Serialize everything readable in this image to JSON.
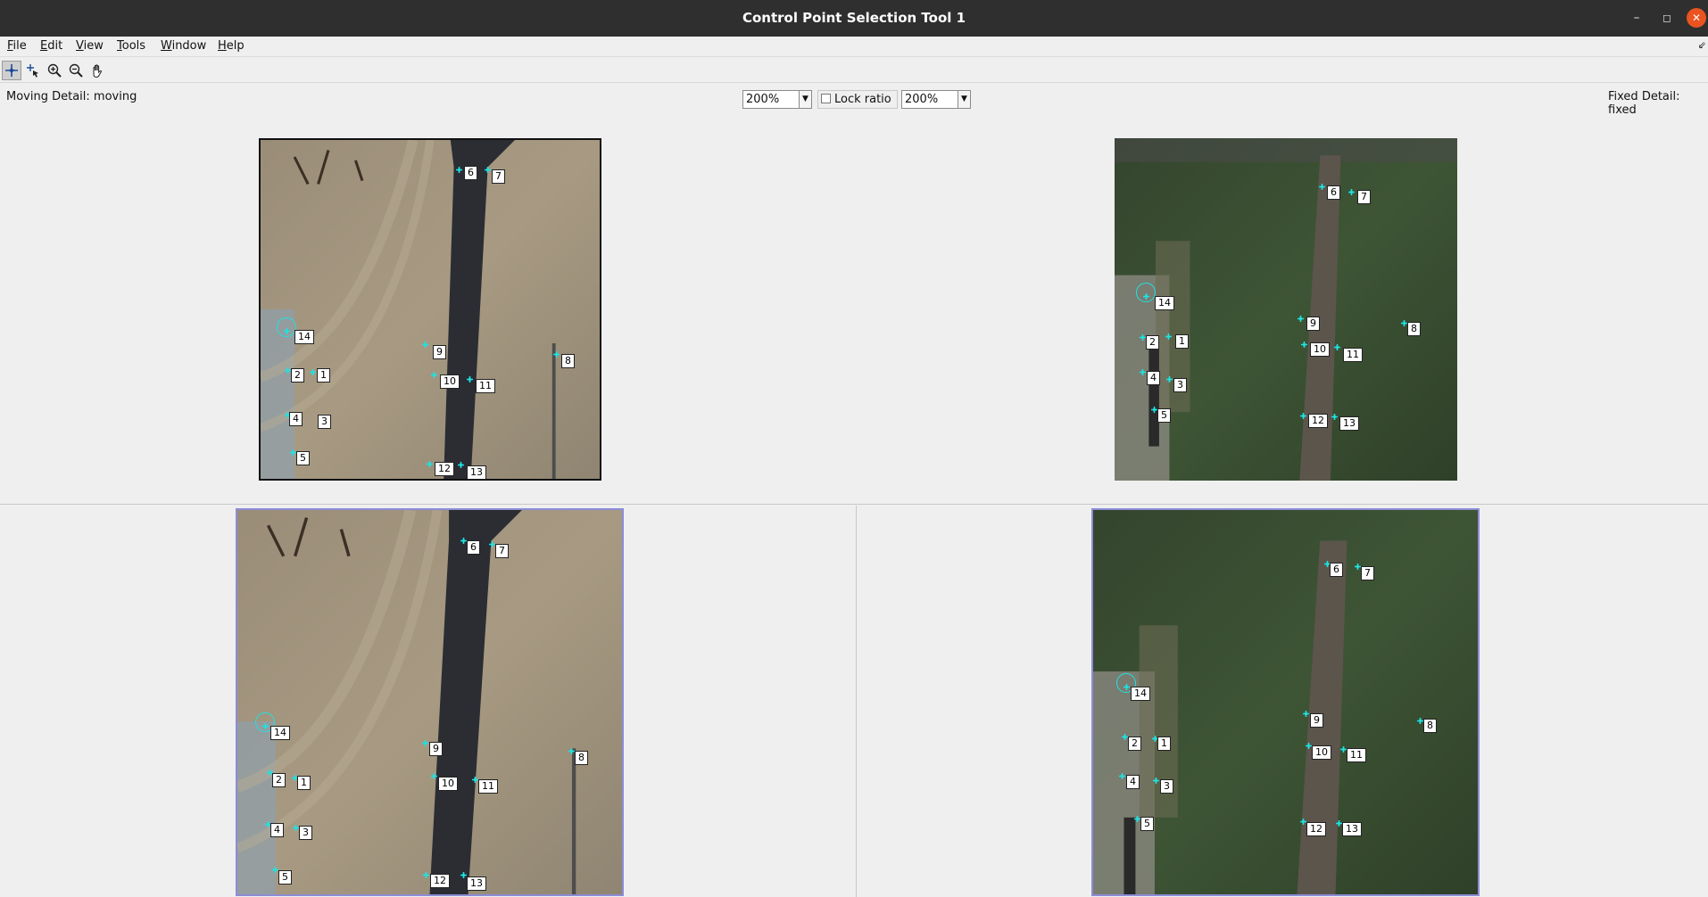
{
  "window": {
    "title": "Control Point Selection Tool 1"
  },
  "menu": [
    {
      "label": "File",
      "u": "F",
      "rest": "ile"
    },
    {
      "label": "Edit",
      "u": "E",
      "rest": "dit"
    },
    {
      "label": "View",
      "u": "V",
      "rest": "iew"
    },
    {
      "label": "Tools",
      "u": "T",
      "rest": "ools"
    },
    {
      "label": "Window",
      "u": "W",
      "rest": "indow"
    },
    {
      "label": "Help",
      "u": "H",
      "rest": "elp"
    }
  ],
  "toolbar": {
    "tools": [
      "add-point-icon",
      "select-point-icon",
      "zoom-in-icon",
      "zoom-out-icon",
      "pan-hand-icon"
    ],
    "active": "add-point-icon"
  },
  "detail": {
    "moving_label": "Moving Detail: moving",
    "fixed_label": "Fixed Detail: fixed",
    "moving_zoom": "200%",
    "fixed_zoom": "200%",
    "lock_ratio_label": "Lock ratio",
    "lock_ratio_checked": false
  },
  "control_points": {
    "labels": [
      "1",
      "2",
      "3",
      "4",
      "5",
      "6",
      "7",
      "8",
      "9",
      "10",
      "11",
      "12",
      "13",
      "14"
    ],
    "marker_color": "#1de3e3",
    "selected_point": "14"
  },
  "colors": {
    "title_bar": "#2f2f2f",
    "close_button": "#e95420",
    "frame_border": "#8c8cd8"
  }
}
